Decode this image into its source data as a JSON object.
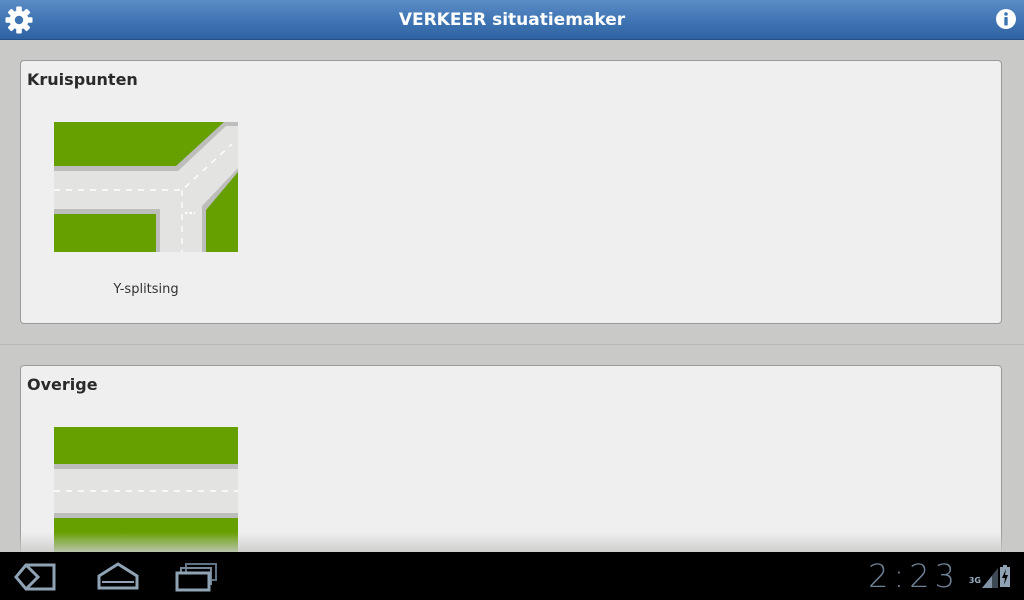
{
  "app": {
    "title": "VERKEER situatiemaker"
  },
  "titlebar": {
    "settings_icon": "gear-icon",
    "info_icon": "info-icon"
  },
  "sections": [
    {
      "title": "Kruispunten",
      "items": [
        {
          "label": "Y-splitsing",
          "thumbnail": "y-junction"
        }
      ]
    },
    {
      "title": "Overige",
      "items": [
        {
          "label": "",
          "thumbnail": "straight-road"
        }
      ]
    }
  ],
  "colors": {
    "titlebar": "#3f74b2",
    "grass": "#66a000",
    "road": "#e2e2e0",
    "curb": "#bdbdbb",
    "panel": "#efefef",
    "background": "#c9cac8"
  },
  "system_bar": {
    "clock": "2:23",
    "network": "3G",
    "back_icon": "back-icon",
    "home_icon": "home-icon",
    "recent_icon": "recent-apps-icon",
    "signal_icon": "signal-icon",
    "battery_icon": "battery-charging-icon"
  }
}
